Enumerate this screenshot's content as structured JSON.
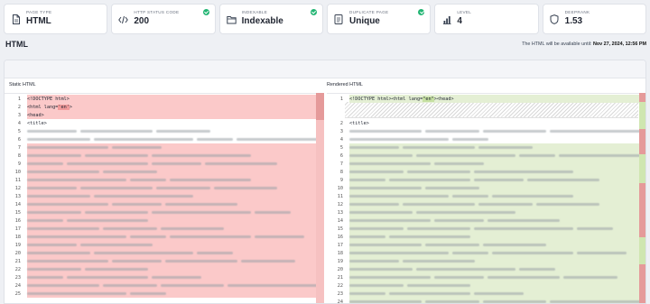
{
  "cards": [
    {
      "label": "PAGE TYPE",
      "value": "HTML",
      "icon": "file-icon",
      "check": false
    },
    {
      "label": "HTTP STATUS CODE",
      "value": "200",
      "icon": "code-icon",
      "check": true
    },
    {
      "label": "INDEXABLE",
      "value": "Indexable",
      "icon": "folder-icon",
      "check": true
    },
    {
      "label": "DUPLICATE PAGE",
      "value": "Unique",
      "icon": "document-icon",
      "check": true
    },
    {
      "label": "LEVEL",
      "value": "4",
      "icon": "bar-chart-icon",
      "check": false
    },
    {
      "label": "DEEPRANK",
      "value": "1.53",
      "icon": "shield-icon",
      "check": false
    }
  ],
  "header": {
    "title": "HTML",
    "availability_prefix": "The HTML will be available until:",
    "availability_date": "Nov 27, 2024, 12:56 PM"
  },
  "left_pane": {
    "title": "Static HTML",
    "lines": [
      {
        "n": "1",
        "text": "<!DOCTYPE html>"
      },
      {
        "n": "2",
        "pre": "<html lang=",
        "str": "'en'",
        "post": ">"
      },
      {
        "n": "3",
        "text": "<head>"
      },
      {
        "n": "4",
        "text": "<title>"
      },
      {
        "n": "5"
      },
      {
        "n": "6"
      },
      {
        "n": "7"
      },
      {
        "n": "8"
      },
      {
        "n": "9"
      },
      {
        "n": "10"
      },
      {
        "n": "11"
      },
      {
        "n": "12"
      },
      {
        "n": "13"
      },
      {
        "n": "14"
      },
      {
        "n": "15"
      },
      {
        "n": "16"
      },
      {
        "n": "17"
      },
      {
        "n": "18"
      },
      {
        "n": "19"
      },
      {
        "n": "20"
      },
      {
        "n": "21"
      },
      {
        "n": "22"
      },
      {
        "n": "23"
      },
      {
        "n": "24"
      },
      {
        "n": "25"
      }
    ]
  },
  "right_pane": {
    "title": "Rendered HTML",
    "lines": [
      {
        "n": "1",
        "pre": "<!DOCTYPE html><html lang=",
        "str": "\"en\"",
        "post": "><head>"
      },
      {
        "n": "2",
        "text": "<title>"
      },
      {
        "n": "3"
      },
      {
        "n": "4"
      },
      {
        "n": "5"
      },
      {
        "n": "6"
      },
      {
        "n": "7"
      },
      {
        "n": "8"
      },
      {
        "n": "9"
      },
      {
        "n": "10"
      },
      {
        "n": "11"
      },
      {
        "n": "12"
      },
      {
        "n": "13"
      },
      {
        "n": "14"
      },
      {
        "n": "15"
      },
      {
        "n": "16"
      },
      {
        "n": "17"
      },
      {
        "n": "18"
      },
      {
        "n": "19"
      },
      {
        "n": "20"
      },
      {
        "n": "21"
      },
      {
        "n": "22"
      },
      {
        "n": "23"
      },
      {
        "n": "24"
      }
    ]
  },
  "colors": {
    "check": "#22b573",
    "removed": "#fbc9c9",
    "added": "#e4efd4"
  }
}
